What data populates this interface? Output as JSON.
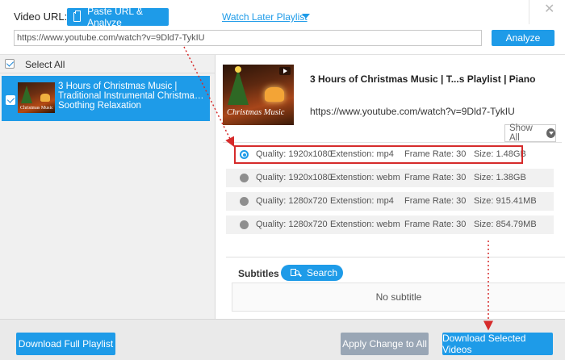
{
  "header": {
    "url_label": "Video URL:",
    "paste_button": "Paste URL & Analyze",
    "watch_later": "Watch Later Playlist",
    "url_value": "https://www.youtube.com/watch?v=9Dld7-TykIU",
    "analyze_button": "Analyze",
    "close_symbol": "✕"
  },
  "left_panel": {
    "select_all_label": "Select All",
    "select_all_checked": true,
    "items": [
      {
        "title": "3 Hours of Christmas Music | Traditional Instrumental Christma… Soothing Relaxation",
        "thumb_text": "Christmas Music",
        "checked": true
      }
    ]
  },
  "detail": {
    "thumb_text": "Christmas Music",
    "title": "3 Hours of Christmas Music | T...s Playlist | Piano",
    "url": "https://www.youtube.com/watch?v=9Dld7-TykIU",
    "show_all": "Show All",
    "formats": [
      {
        "quality": "Quality: 1920x1080",
        "extension": "Extenstion: mp4",
        "frame_rate": "Frame Rate: 30",
        "size": "Size: 1.48GB",
        "selected": true
      },
      {
        "quality": "Quality: 1920x1080",
        "extension": "Extenstion: webm",
        "frame_rate": "Frame Rate: 30",
        "size": "Size: 1.38GB",
        "selected": false
      },
      {
        "quality": "Quality: 1280x720",
        "extension": "Extenstion: mp4",
        "frame_rate": "Frame Rate: 30",
        "size": "Size: 915.41MB",
        "selected": false
      },
      {
        "quality": "Quality: 1280x720",
        "extension": "Extenstion: webm",
        "frame_rate": "Frame Rate: 30",
        "size": "Size: 854.79MB",
        "selected": false
      }
    ],
    "subtitles_label": "Subtitles",
    "search_button": "Search",
    "no_subtitle": "No subtitle"
  },
  "footer": {
    "download_playlist": "Download Full Playlist",
    "apply_change": "Apply Change to All",
    "download_selected": "Download Selected Videos"
  },
  "colors": {
    "accent": "#1e9be8",
    "highlight_box": "#d62b2b",
    "disabled_button": "#99a6b5"
  }
}
